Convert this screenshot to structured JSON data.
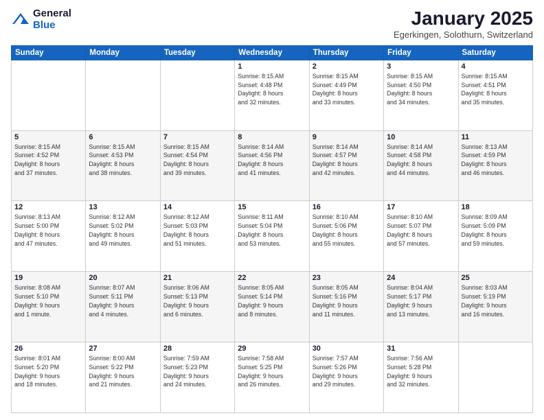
{
  "header": {
    "logo_general": "General",
    "logo_blue": "Blue",
    "month_title": "January 2025",
    "location": "Egerkingen, Solothurn, Switzerland"
  },
  "days_of_week": [
    "Sunday",
    "Monday",
    "Tuesday",
    "Wednesday",
    "Thursday",
    "Friday",
    "Saturday"
  ],
  "weeks": [
    [
      {
        "day": "",
        "info": ""
      },
      {
        "day": "",
        "info": ""
      },
      {
        "day": "",
        "info": ""
      },
      {
        "day": "1",
        "info": "Sunrise: 8:15 AM\nSunset: 4:48 PM\nDaylight: 8 hours\nand 32 minutes."
      },
      {
        "day": "2",
        "info": "Sunrise: 8:15 AM\nSunset: 4:49 PM\nDaylight: 8 hours\nand 33 minutes."
      },
      {
        "day": "3",
        "info": "Sunrise: 8:15 AM\nSunset: 4:50 PM\nDaylight: 8 hours\nand 34 minutes."
      },
      {
        "day": "4",
        "info": "Sunrise: 8:15 AM\nSunset: 4:51 PM\nDaylight: 8 hours\nand 35 minutes."
      }
    ],
    [
      {
        "day": "5",
        "info": "Sunrise: 8:15 AM\nSunset: 4:52 PM\nDaylight: 8 hours\nand 37 minutes."
      },
      {
        "day": "6",
        "info": "Sunrise: 8:15 AM\nSunset: 4:53 PM\nDaylight: 8 hours\nand 38 minutes."
      },
      {
        "day": "7",
        "info": "Sunrise: 8:15 AM\nSunset: 4:54 PM\nDaylight: 8 hours\nand 39 minutes."
      },
      {
        "day": "8",
        "info": "Sunrise: 8:14 AM\nSunset: 4:56 PM\nDaylight: 8 hours\nand 41 minutes."
      },
      {
        "day": "9",
        "info": "Sunrise: 8:14 AM\nSunset: 4:57 PM\nDaylight: 8 hours\nand 42 minutes."
      },
      {
        "day": "10",
        "info": "Sunrise: 8:14 AM\nSunset: 4:58 PM\nDaylight: 8 hours\nand 44 minutes."
      },
      {
        "day": "11",
        "info": "Sunrise: 8:13 AM\nSunset: 4:59 PM\nDaylight: 8 hours\nand 46 minutes."
      }
    ],
    [
      {
        "day": "12",
        "info": "Sunrise: 8:13 AM\nSunset: 5:00 PM\nDaylight: 8 hours\nand 47 minutes."
      },
      {
        "day": "13",
        "info": "Sunrise: 8:12 AM\nSunset: 5:02 PM\nDaylight: 8 hours\nand 49 minutes."
      },
      {
        "day": "14",
        "info": "Sunrise: 8:12 AM\nSunset: 5:03 PM\nDaylight: 8 hours\nand 51 minutes."
      },
      {
        "day": "15",
        "info": "Sunrise: 8:11 AM\nSunset: 5:04 PM\nDaylight: 8 hours\nand 53 minutes."
      },
      {
        "day": "16",
        "info": "Sunrise: 8:10 AM\nSunset: 5:06 PM\nDaylight: 8 hours\nand 55 minutes."
      },
      {
        "day": "17",
        "info": "Sunrise: 8:10 AM\nSunset: 5:07 PM\nDaylight: 8 hours\nand 57 minutes."
      },
      {
        "day": "18",
        "info": "Sunrise: 8:09 AM\nSunset: 5:09 PM\nDaylight: 8 hours\nand 59 minutes."
      }
    ],
    [
      {
        "day": "19",
        "info": "Sunrise: 8:08 AM\nSunset: 5:10 PM\nDaylight: 9 hours\nand 1 minute."
      },
      {
        "day": "20",
        "info": "Sunrise: 8:07 AM\nSunset: 5:11 PM\nDaylight: 9 hours\nand 4 minutes."
      },
      {
        "day": "21",
        "info": "Sunrise: 8:06 AM\nSunset: 5:13 PM\nDaylight: 9 hours\nand 6 minutes."
      },
      {
        "day": "22",
        "info": "Sunrise: 8:05 AM\nSunset: 5:14 PM\nDaylight: 9 hours\nand 8 minutes."
      },
      {
        "day": "23",
        "info": "Sunrise: 8:05 AM\nSunset: 5:16 PM\nDaylight: 9 hours\nand 11 minutes."
      },
      {
        "day": "24",
        "info": "Sunrise: 8:04 AM\nSunset: 5:17 PM\nDaylight: 9 hours\nand 13 minutes."
      },
      {
        "day": "25",
        "info": "Sunrise: 8:03 AM\nSunset: 5:19 PM\nDaylight: 9 hours\nand 16 minutes."
      }
    ],
    [
      {
        "day": "26",
        "info": "Sunrise: 8:01 AM\nSunset: 5:20 PM\nDaylight: 9 hours\nand 18 minutes."
      },
      {
        "day": "27",
        "info": "Sunrise: 8:00 AM\nSunset: 5:22 PM\nDaylight: 9 hours\nand 21 minutes."
      },
      {
        "day": "28",
        "info": "Sunrise: 7:59 AM\nSunset: 5:23 PM\nDaylight: 9 hours\nand 24 minutes."
      },
      {
        "day": "29",
        "info": "Sunrise: 7:58 AM\nSunset: 5:25 PM\nDaylight: 9 hours\nand 26 minutes."
      },
      {
        "day": "30",
        "info": "Sunrise: 7:57 AM\nSunset: 5:26 PM\nDaylight: 9 hours\nand 29 minutes."
      },
      {
        "day": "31",
        "info": "Sunrise: 7:56 AM\nSunset: 5:28 PM\nDaylight: 9 hours\nand 32 minutes."
      },
      {
        "day": "",
        "info": ""
      }
    ]
  ]
}
